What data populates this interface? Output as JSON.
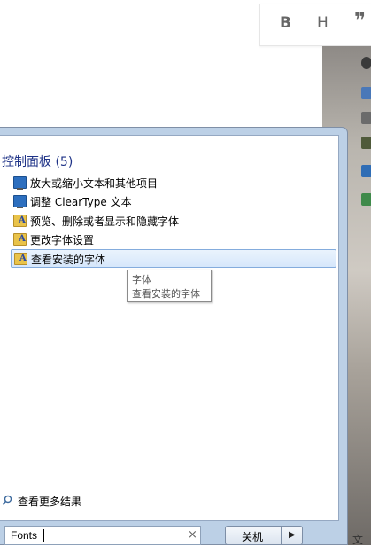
{
  "toolbar": {
    "bold": "B",
    "heading": "H",
    "quote": "❞"
  },
  "desktop": {
    "partial_text": "文"
  },
  "start_menu": {
    "section_title": "控制面板 (5)",
    "items": [
      {
        "label": "放大或缩小文本和其他项目",
        "icon": "monitor-icon"
      },
      {
        "label": "调整 ClearType 文本",
        "icon": "monitor-icon"
      },
      {
        "label": "预览、删除或者显示和隐藏字体",
        "icon": "fonts-folder-icon"
      },
      {
        "label": "更改字体设置",
        "icon": "fonts-folder-icon"
      },
      {
        "label": "查看安装的字体",
        "icon": "fonts-folder-icon",
        "selected": true
      }
    ],
    "tooltip": {
      "title": "字体",
      "description": "查看安装的字体"
    },
    "see_more": "查看更多结果",
    "search": {
      "value": "Fonts",
      "clear": "×"
    },
    "shutdown": {
      "label": "关机",
      "arrow": "▶"
    }
  }
}
